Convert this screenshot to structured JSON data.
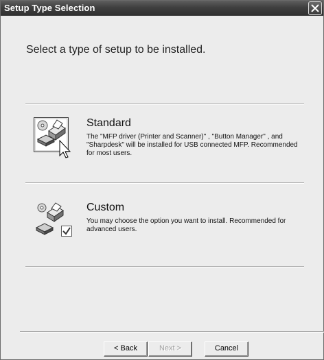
{
  "window": {
    "title": "Setup Type Selection"
  },
  "heading": "Select a type of setup to be installed.",
  "options": [
    {
      "title": "Standard",
      "description": "The \"MFP driver (Printer and Scanner)\" , \"Button Manager\" , and \"Sharpdesk\" will be installed for USB connected MFP. Recommended for most users.",
      "icon": "standard-setup-icon"
    },
    {
      "title": "Custom",
      "description": "You may choose the option you want to install. Recommended for advanced users.",
      "icon": "custom-setup-icon"
    }
  ],
  "buttons": {
    "back": "< Back",
    "next": "Next >",
    "cancel": "Cancel"
  },
  "colors": {
    "titlebar": "#3f3f3f",
    "dialog_bg": "#ececec"
  }
}
